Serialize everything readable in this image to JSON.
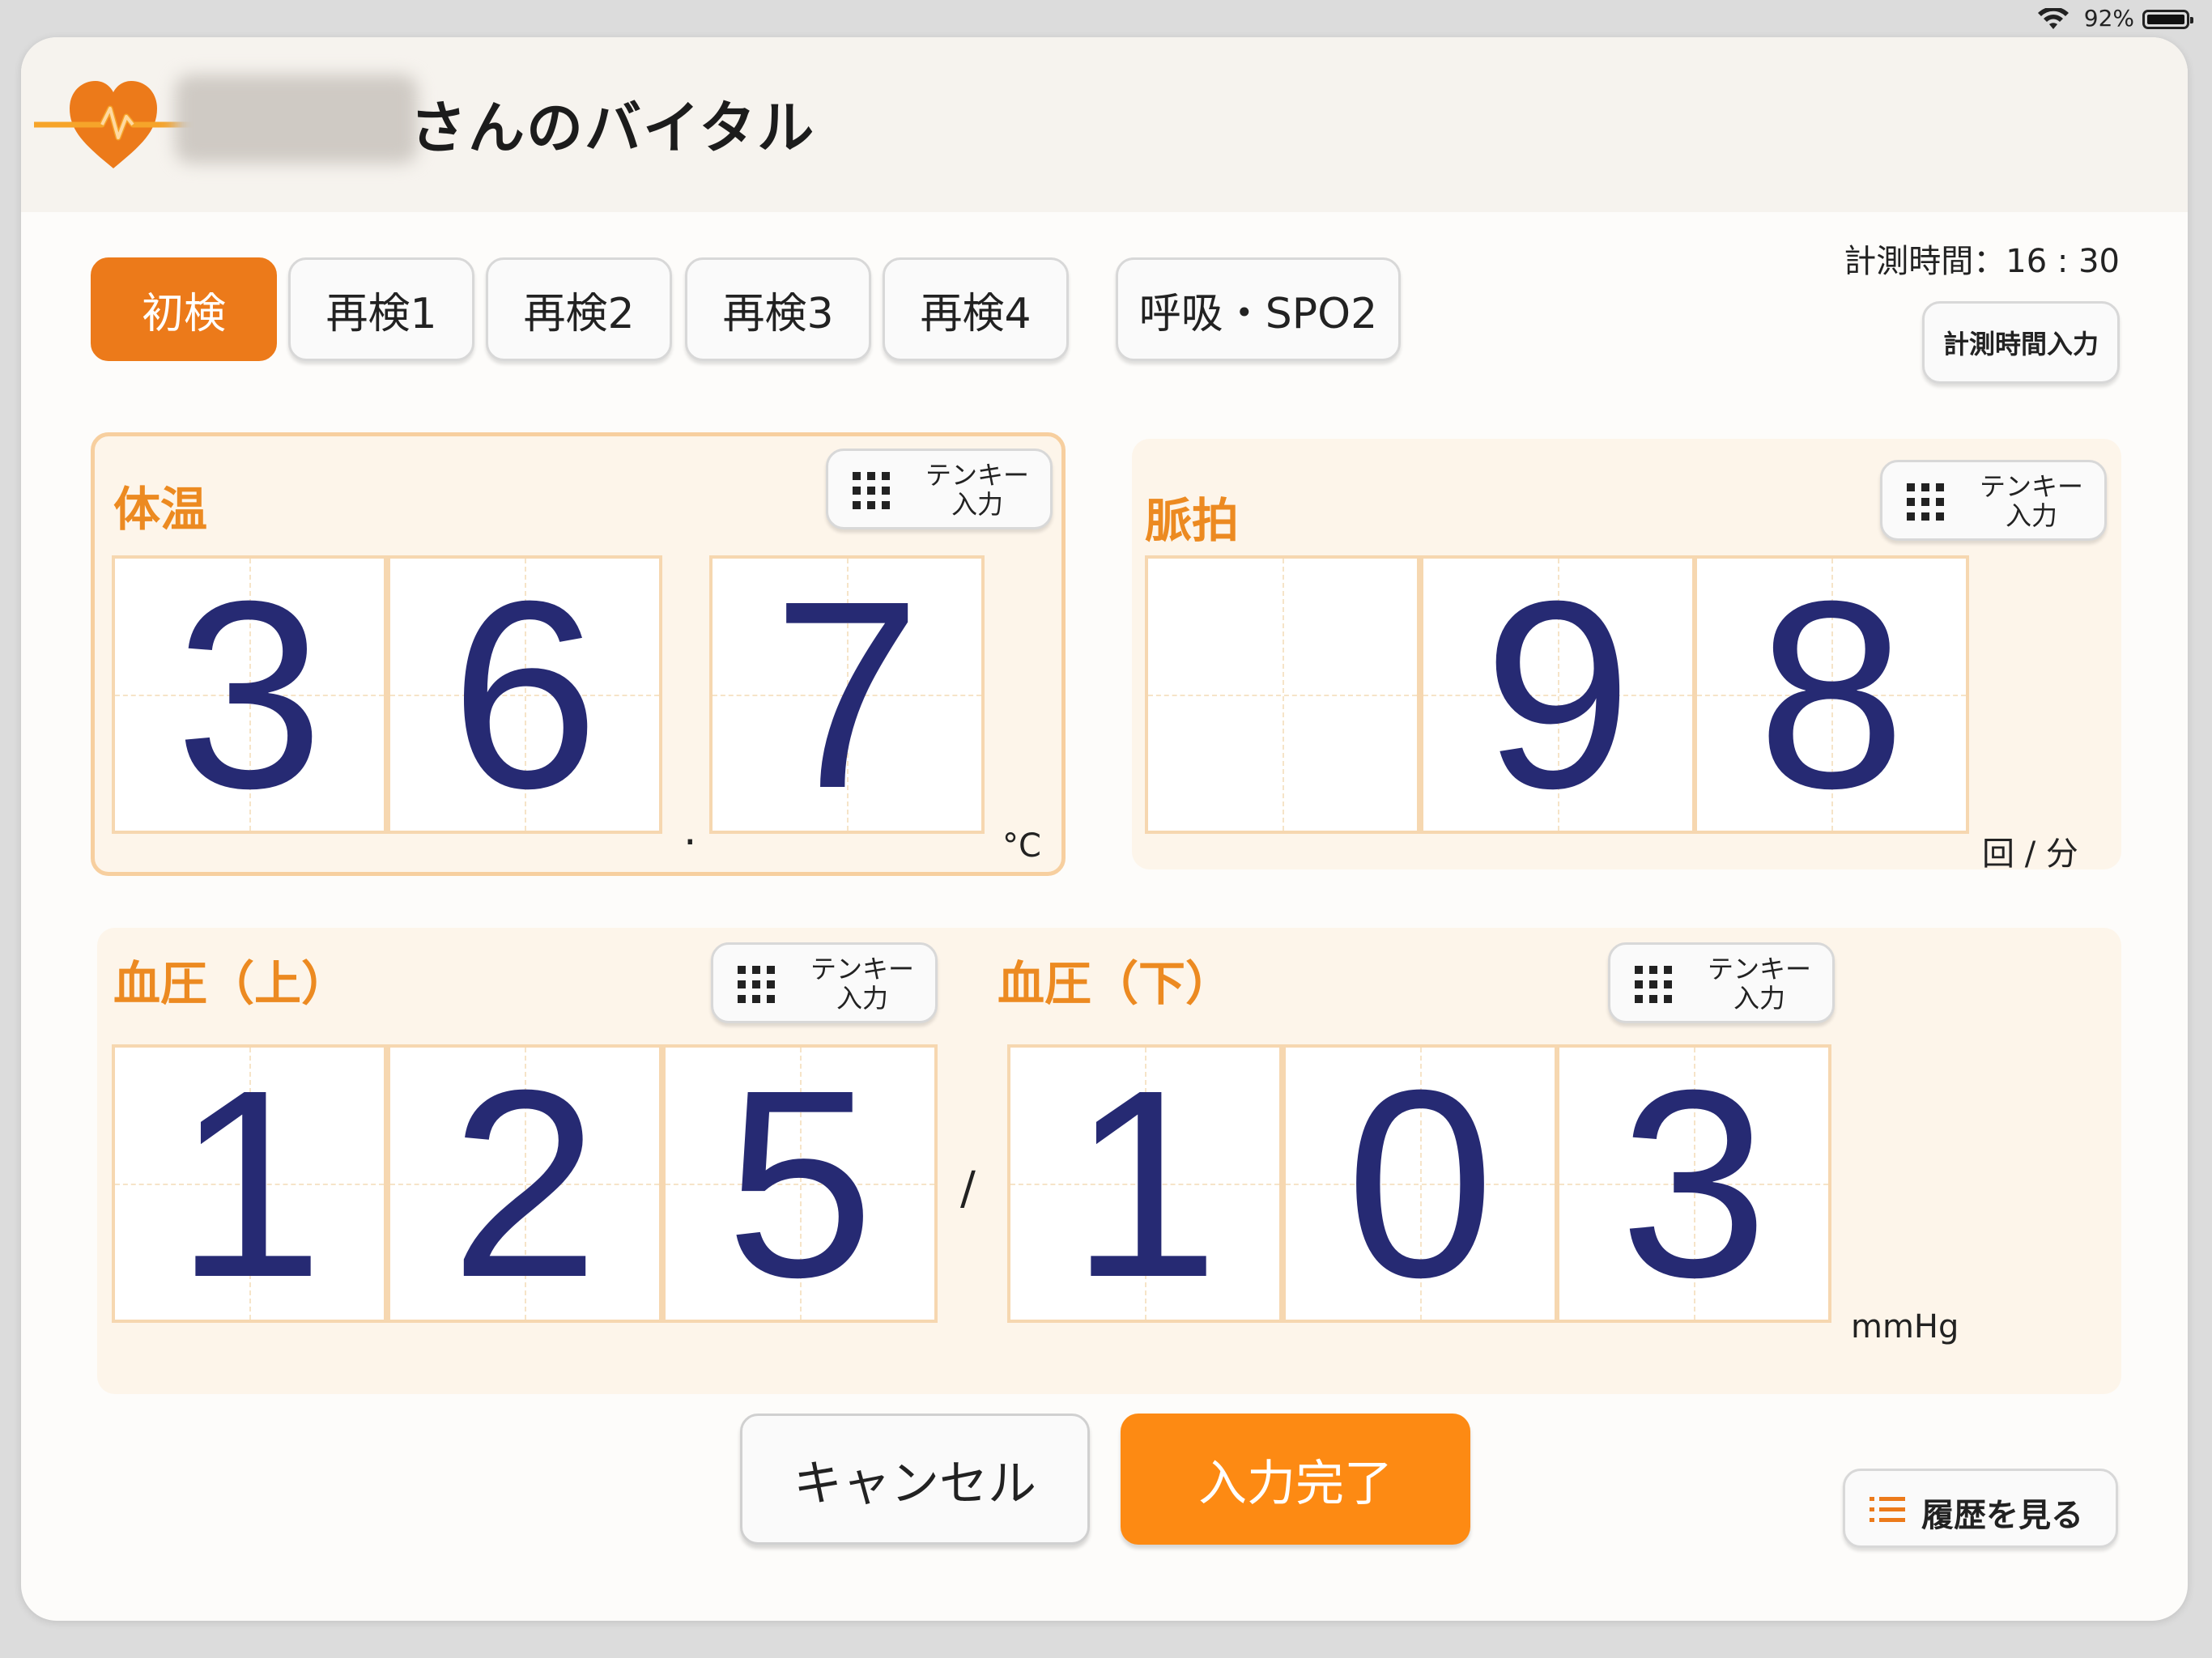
{
  "status_bar": {
    "battery": "92%"
  },
  "header": {
    "title": "さんのバイタル"
  },
  "tabs": [
    {
      "label": "初検"
    },
    {
      "label": "再検1"
    },
    {
      "label": "再検2"
    },
    {
      "label": "再検3"
    },
    {
      "label": "再検4"
    },
    {
      "label": "呼吸・SPO2"
    }
  ],
  "measurement": {
    "time_label": "計測時間：16 : 30",
    "time_input_label": "計測時間入力"
  },
  "tenkey_label": [
    "テンキー",
    "入力"
  ],
  "temperature": {
    "label": "体温",
    "digits": [
      "3",
      "6",
      "7"
    ],
    "decimal_point": ".",
    "unit": "°C"
  },
  "pulse": {
    "label": "脈拍",
    "digits": [
      "",
      "9",
      "8"
    ],
    "unit": "回 / 分"
  },
  "bp_upper": {
    "label": "血圧（上）",
    "digits": [
      "1",
      "2",
      "5"
    ]
  },
  "bp_separator": "/",
  "bp_lower": {
    "label": "血圧（下）",
    "digits": [
      "1",
      "0",
      "3"
    ]
  },
  "bp_unit": "mmHg",
  "actions": {
    "cancel": "キャンセル",
    "done": "入力完了",
    "history": "履歴を見る"
  },
  "colors": {
    "accent": "#ec7a1a",
    "digit": "#262a73",
    "label": "#ec8a21"
  }
}
